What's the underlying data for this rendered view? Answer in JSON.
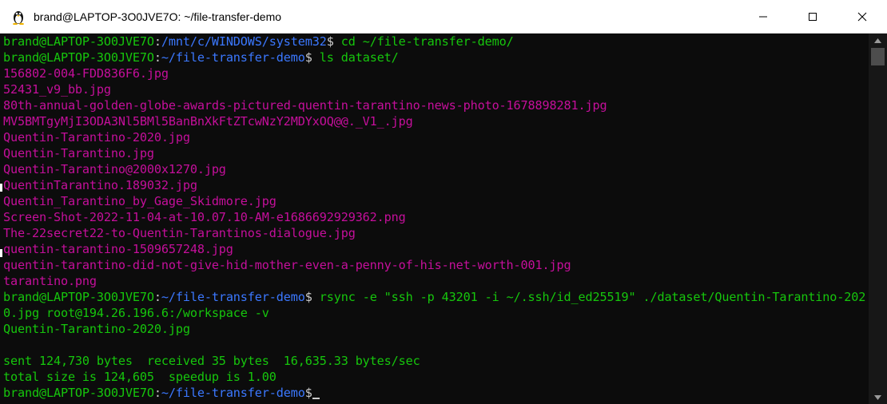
{
  "window": {
    "title": "brand@LAPTOP-3O0JVE7O: ~/file-transfer-demo",
    "app_icon": "linux-penguin-icon"
  },
  "colors": {
    "background": "#0c0c0c",
    "prompt_user": "#16c60c",
    "prompt_path": "#3b78ff",
    "file_listing": "#c50f9b",
    "text": "#cccccc"
  },
  "terminal": {
    "lines": [
      {
        "type": "prompt",
        "user": "brand@LAPTOP-3O0JVE7O",
        "path": "/mnt/c/WINDOWS/system32",
        "cmd": " cd ~/file-transfer-demo/"
      },
      {
        "type": "prompt",
        "user": "brand@LAPTOP-3O0JVE7O",
        "path": "~/file-transfer-demo",
        "cmd": " ls dataset/"
      },
      {
        "type": "file",
        "text": "156802-004-FDD836F6.jpg"
      },
      {
        "type": "file",
        "text": "52431_v9_bb.jpg"
      },
      {
        "type": "file",
        "text": "80th-annual-golden-globe-awards-pictured-quentin-tarantino-news-photo-1678898281.jpg"
      },
      {
        "type": "file",
        "text": "MV5BMTgyMjI3ODA3Nl5BMl5BanBnXkFtZTcwNzY2MDYxOQ@@._V1_.jpg"
      },
      {
        "type": "file",
        "text": "Quentin-Tarantino-2020.jpg"
      },
      {
        "type": "file",
        "text": "Quentin-Tarantino.jpg"
      },
      {
        "type": "file",
        "text": "Quentin-Tarantino@2000x1270.jpg"
      },
      {
        "type": "file",
        "text": "QuentinTarantino.189032.jpg"
      },
      {
        "type": "file",
        "text": "Quentin_Tarantino_by_Gage_Skidmore.jpg"
      },
      {
        "type": "file",
        "text": "Screen-Shot-2022-11-04-at-10.07.10-AM-e1686692929362.png"
      },
      {
        "type": "file",
        "text": "The-22secret22-to-Quentin-Tarantinos-dialogue.jpg"
      },
      {
        "type": "file",
        "text": "quentin-tarantino-1509657248.jpg"
      },
      {
        "type": "file",
        "text": "quentin-tarantino-did-not-give-hid-mother-even-a-penny-of-his-net-worth-001.jpg"
      },
      {
        "type": "file",
        "text": "tarantino.png"
      },
      {
        "type": "prompt",
        "user": "brand@LAPTOP-3O0JVE7O",
        "path": "~/file-transfer-demo",
        "cmd": " rsync -e \"ssh -p 43201 -i ~/.ssh/id_ed25519\" ./dataset/Quentin-Tarantino-202"
      },
      {
        "type": "out",
        "text": "0.jpg root@194.26.196.6:/workspace -v"
      },
      {
        "type": "out",
        "text": "Quentin-Tarantino-2020.jpg"
      },
      {
        "type": "out",
        "text": ""
      },
      {
        "type": "out",
        "text": "sent 124,730 bytes  received 35 bytes  16,635.33 bytes/sec"
      },
      {
        "type": "out",
        "text": "total size is 124,605  speedup is 1.00"
      },
      {
        "type": "prompt",
        "user": "brand@LAPTOP-3O0JVE7O",
        "path": "~/file-transfer-demo",
        "cmd": "",
        "cursor": true
      }
    ]
  }
}
